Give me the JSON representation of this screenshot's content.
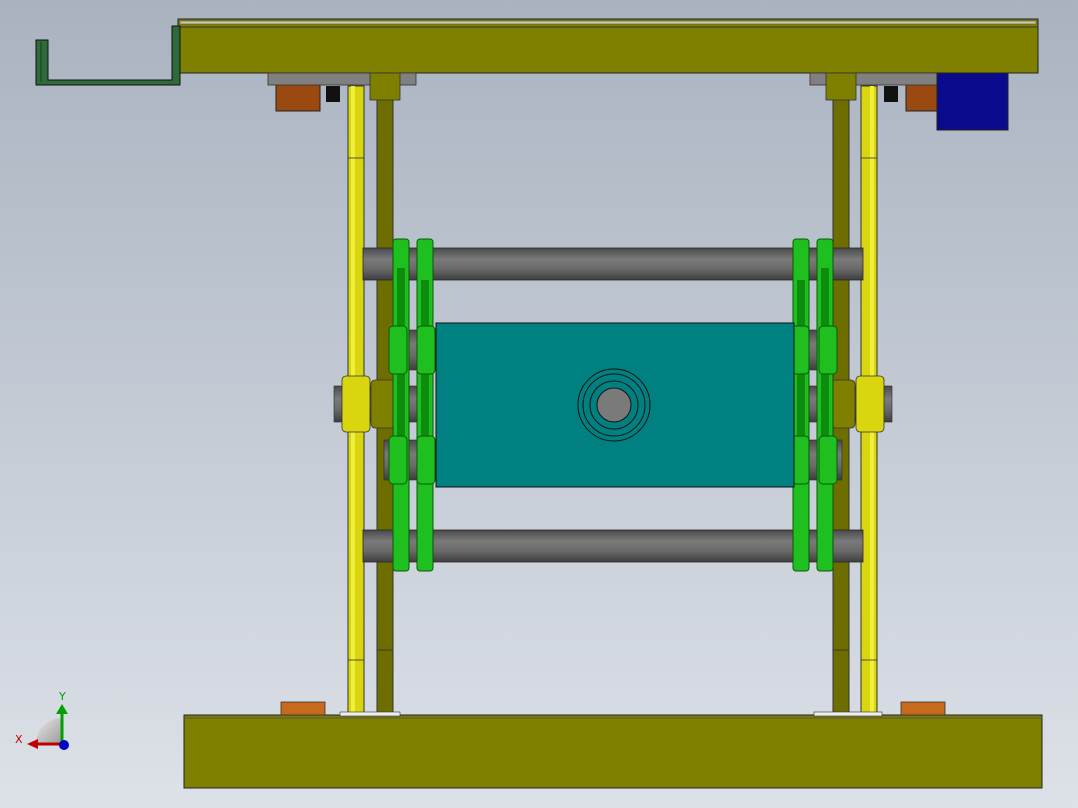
{
  "viewport": {
    "background_top": "#a9b3c0",
    "background_bottom": "#dde1e8"
  },
  "colors": {
    "olive": "#808000",
    "olive_dark": "#6e6e00",
    "yellow": "#d9d60f",
    "yellow_light": "#f2ef3a",
    "green": "#1fbf1f",
    "green_dark": "#0e8c0e",
    "teal": "#008080",
    "gray_rod": "#5f5f5f",
    "brown": "#9a4a10",
    "orange": "#c86a1e",
    "blue": "#0a0a8c",
    "dark_green_bracket": "#2f6b3a",
    "axis_x": "#c00000",
    "axis_y": "#00a000",
    "axis_z": "#0000c0"
  },
  "triad": {
    "x_label": "X",
    "y_label": "Y",
    "x_icon": "x-axis-arrow-icon",
    "y_icon": "y-axis-arrow-icon",
    "z_icon": "z-axis-dot-icon"
  }
}
